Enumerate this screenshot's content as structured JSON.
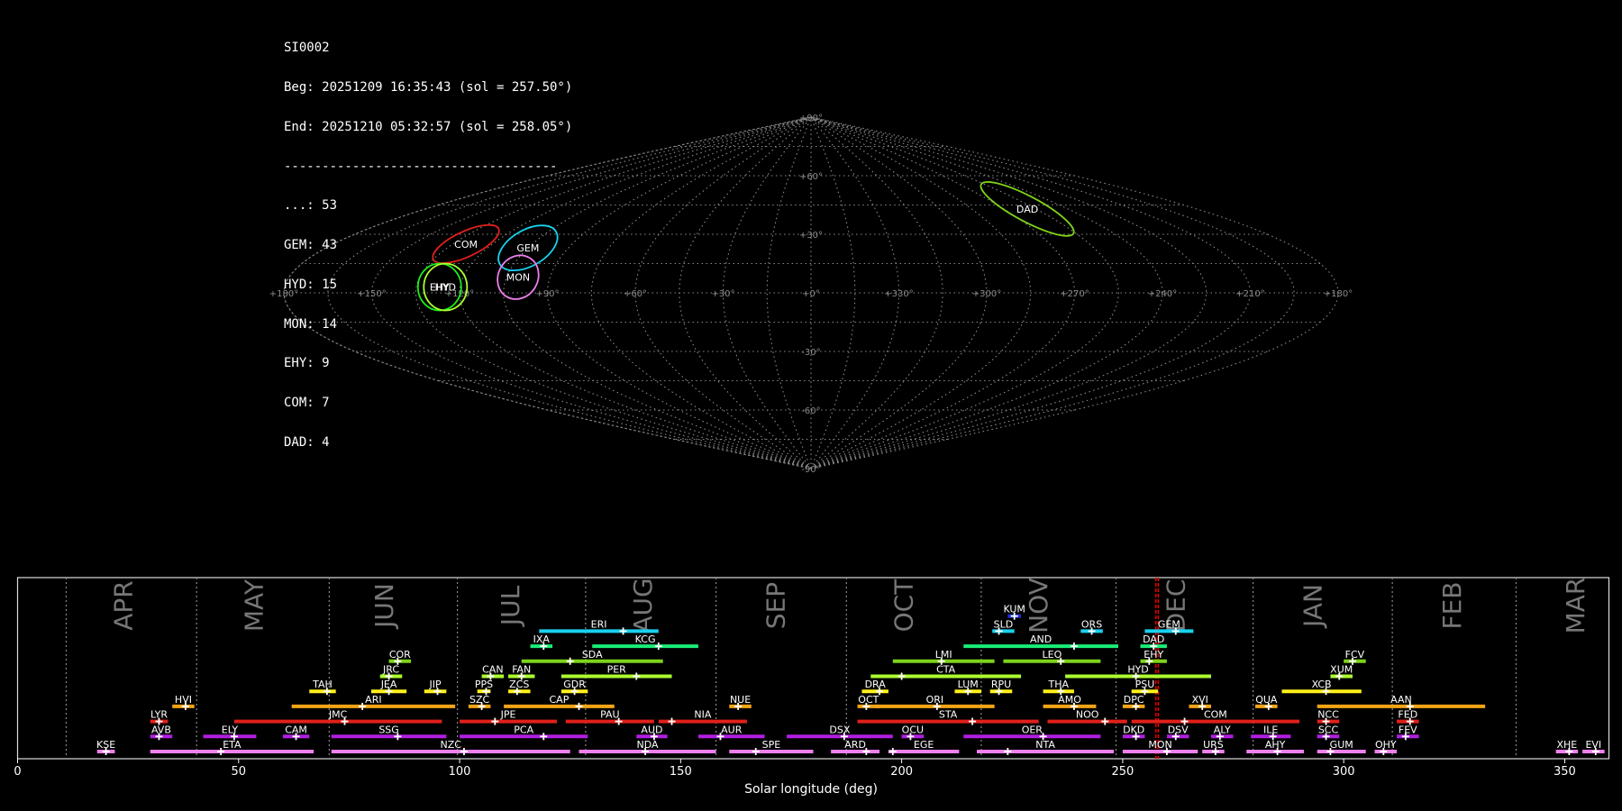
{
  "info": {
    "station": "SI0002",
    "begin": "Beg: 20251209 16:35:43 (sol = 257.50°)",
    "end": "End: 20251210 05:32:57 (sol = 258.05°)",
    "separator": "------------------------------------",
    "counts": [
      "...: 53",
      "GEM: 43",
      "HYD: 15",
      "MON: 14",
      "EHY: 9",
      "COM: 7",
      "DAD: 4"
    ]
  },
  "sky_map": {
    "projection": "sinusoidal",
    "lon_labels": [
      "+180°",
      "+150°",
      "+120°",
      "+90°",
      "+60°",
      "+30°",
      "+0°",
      "+330°",
      "+300°",
      "+270°",
      "+240°",
      "+210°",
      "+180°"
    ],
    "lat_labels": [
      "+90°",
      "+60°",
      "+30°",
      "+0°",
      "-30°",
      "-60°",
      "-90°"
    ],
    "showers": [
      {
        "code": "COM",
        "color": "#e0201a",
        "ra": 130,
        "dec": 25
      },
      {
        "code": "GEM",
        "color": "#19d2ee",
        "ra": 105,
        "dec": 23
      },
      {
        "code": "MON",
        "color": "#ee80ee",
        "ra": 101,
        "dec": 8
      },
      {
        "code": "EHY",
        "color": "#19ee19",
        "ra": 127,
        "dec": 3
      },
      {
        "code": "HYD",
        "color": "#adff2f",
        "ra": 125,
        "dec": 3
      },
      {
        "code": "DAD",
        "color": "#7ed31a",
        "ra": 259,
        "dec": 43
      }
    ]
  },
  "chart_data": {
    "type": "timeline",
    "xlabel": "Solar longitude (deg)",
    "xlim": [
      0,
      360
    ],
    "xticks": [
      0,
      50,
      100,
      150,
      200,
      250,
      300,
      350
    ],
    "current_sol": [
      257.5,
      258.05
    ],
    "months": [
      {
        "name": "APR",
        "start": 11,
        "label_at": 24
      },
      {
        "name": "MAY",
        "start": 40.5,
        "label_at": 53.5
      },
      {
        "name": "JUN",
        "start": 70.5,
        "label_at": 83
      },
      {
        "name": "JUL",
        "start": 99.5,
        "label_at": 111.5
      },
      {
        "name": "AUG",
        "start": 128.5,
        "label_at": 141.5
      },
      {
        "name": "SEP",
        "start": 158,
        "label_at": 171.5
      },
      {
        "name": "OCT",
        "start": 187.5,
        "label_at": 200.5
      },
      {
        "name": "NOV",
        "start": 218,
        "label_at": 231
      },
      {
        "name": "DEC",
        "start": 248.5,
        "label_at": 262
      },
      {
        "name": "JAN",
        "start": 279.5,
        "label_at": 293
      },
      {
        "name": "FEB",
        "start": 311,
        "label_at": 324.5
      },
      {
        "name": "MAR",
        "start": 339,
        "label_at": 352.5
      }
    ],
    "showers": [
      {
        "code": "KUM",
        "start": 224,
        "end": 227,
        "peak": 225.5,
        "row": 9,
        "color": "#1f2fd6"
      },
      {
        "code": "ERI",
        "start": 118,
        "end": 145,
        "peak": 137,
        "row": 8,
        "color": "#19d2ee"
      },
      {
        "code": "SLD",
        "start": 220.5,
        "end": 225.5,
        "peak": 222,
        "row": 8,
        "color": "#19d2ee"
      },
      {
        "code": "ORS",
        "start": 240.5,
        "end": 245.5,
        "peak": 243,
        "row": 8,
        "color": "#19d2ee"
      },
      {
        "code": "GEM",
        "start": 255,
        "end": 266,
        "peak": 262,
        "row": 8,
        "color": "#19d2ee"
      },
      {
        "code": "IXA",
        "start": 116,
        "end": 121,
        "peak": 119,
        "row": 7,
        "color": "#19ee76"
      },
      {
        "code": "KCG",
        "start": 130,
        "end": 154,
        "peak": 145,
        "row": 7,
        "color": "#19ee76"
      },
      {
        "code": "AND",
        "start": 214,
        "end": 249,
        "peak": 239,
        "row": 7,
        "color": "#19ee76"
      },
      {
        "code": "DAD",
        "start": 254,
        "end": 260,
        "peak": 257,
        "row": 7,
        "color": "#19ee76"
      },
      {
        "code": "COR",
        "start": 84,
        "end": 89,
        "peak": 86,
        "row": 6,
        "color": "#7ed31a"
      },
      {
        "code": "SDA",
        "start": 114,
        "end": 146,
        "peak": 125,
        "row": 6,
        "color": "#7ed31a"
      },
      {
        "code": "LMI",
        "start": 198,
        "end": 221,
        "peak": 209,
        "row": 6,
        "color": "#7ed31a"
      },
      {
        "code": "LEO",
        "start": 223,
        "end": 245,
        "peak": 236,
        "row": 6,
        "color": "#7ed31a"
      },
      {
        "code": "EHY",
        "start": 254,
        "end": 260,
        "peak": 256,
        "row": 6,
        "color": "#7ed31a"
      },
      {
        "code": "FCV",
        "start": 300,
        "end": 305,
        "peak": 302,
        "row": 6,
        "color": "#7ed31a"
      },
      {
        "code": "JRC",
        "start": 82,
        "end": 87,
        "peak": 84,
        "row": 5,
        "color": "#adff2f"
      },
      {
        "code": "CAN",
        "start": 105,
        "end": 110,
        "peak": 107,
        "row": 5,
        "color": "#adff2f"
      },
      {
        "code": "FAN",
        "start": 111,
        "end": 117,
        "peak": 114,
        "row": 5,
        "color": "#adff2f"
      },
      {
        "code": "PER",
        "start": 123,
        "end": 148,
        "peak": 140,
        "row": 5,
        "color": "#adff2f"
      },
      {
        "code": "CTA",
        "start": 193,
        "end": 227,
        "peak": 200,
        "row": 5,
        "color": "#adff2f"
      },
      {
        "code": "HYD",
        "start": 237,
        "end": 270,
        "peak": 253,
        "row": 5,
        "color": "#adff2f"
      },
      {
        "code": "XUM",
        "start": 297,
        "end": 302,
        "peak": 299,
        "row": 5,
        "color": "#adff2f"
      },
      {
        "code": "TAH",
        "start": 66,
        "end": 72,
        "peak": 70,
        "row": 4,
        "color": "#fff119"
      },
      {
        "code": "JEA",
        "start": 80,
        "end": 88,
        "peak": 84,
        "row": 4,
        "color": "#fff119"
      },
      {
        "code": "JIP",
        "start": 92,
        "end": 97,
        "peak": 95,
        "row": 4,
        "color": "#fff119"
      },
      {
        "code": "PPS",
        "start": 104,
        "end": 107,
        "peak": 106,
        "row": 4,
        "color": "#fff119"
      },
      {
        "code": "ZCS",
        "start": 111,
        "end": 116,
        "peak": 113,
        "row": 4,
        "color": "#fff119"
      },
      {
        "code": "GDR",
        "start": 123,
        "end": 129,
        "peak": 126,
        "row": 4,
        "color": "#fff119"
      },
      {
        "code": "DRA",
        "start": 191,
        "end": 197,
        "peak": 195,
        "row": 4,
        "color": "#fff119"
      },
      {
        "code": "LUM",
        "start": 212,
        "end": 218,
        "peak": 215,
        "row": 4,
        "color": "#fff119"
      },
      {
        "code": "RPU",
        "start": 220,
        "end": 225,
        "peak": 222,
        "row": 4,
        "color": "#fff119"
      },
      {
        "code": "THA",
        "start": 232,
        "end": 239,
        "peak": 236,
        "row": 4,
        "color": "#fff119"
      },
      {
        "code": "PSU",
        "start": 252,
        "end": 258,
        "peak": 255,
        "row": 4,
        "color": "#fff119"
      },
      {
        "code": "XCB",
        "start": 286,
        "end": 304,
        "peak": 296,
        "row": 4,
        "color": "#fff119"
      },
      {
        "code": "HVI",
        "start": 35,
        "end": 40,
        "peak": 38,
        "row": 3,
        "color": "#f2a416"
      },
      {
        "code": "ARI",
        "start": 62,
        "end": 99,
        "peak": 78,
        "row": 3,
        "color": "#f2a416"
      },
      {
        "code": "SZC",
        "start": 102,
        "end": 107,
        "peak": 105,
        "row": 3,
        "color": "#f2a416"
      },
      {
        "code": "CAP",
        "start": 110,
        "end": 135,
        "peak": 127,
        "row": 3,
        "color": "#f2a416"
      },
      {
        "code": "NUE",
        "start": 161,
        "end": 166,
        "peak": 163,
        "row": 3,
        "color": "#f2a416"
      },
      {
        "code": "OCT",
        "start": 190,
        "end": 195,
        "peak": 192,
        "row": 3,
        "color": "#f2a416"
      },
      {
        "code": "ORI",
        "start": 194,
        "end": 221,
        "peak": 208,
        "row": 3,
        "color": "#f2a416"
      },
      {
        "code": "AMO",
        "start": 232,
        "end": 244,
        "peak": 239,
        "row": 3,
        "color": "#f2a416"
      },
      {
        "code": "DPC",
        "start": 250,
        "end": 255,
        "peak": 253,
        "row": 3,
        "color": "#f2a416"
      },
      {
        "code": "XVI",
        "start": 265,
        "end": 270,
        "peak": 268,
        "row": 3,
        "color": "#f2a416"
      },
      {
        "code": "QUA",
        "start": 280,
        "end": 285,
        "peak": 283,
        "row": 3,
        "color": "#f2a416"
      },
      {
        "code": "AAN",
        "start": 294,
        "end": 332,
        "peak": 315,
        "row": 3,
        "color": "#f2a416"
      },
      {
        "code": "LYR",
        "start": 30,
        "end": 34,
        "peak": 32,
        "row": 2,
        "color": "#e0201a"
      },
      {
        "code": "JMC",
        "start": 49,
        "end": 96,
        "peak": 74,
        "row": 2,
        "color": "#e0201a"
      },
      {
        "code": "JPE",
        "start": 100,
        "end": 122,
        "peak": 108,
        "row": 2,
        "color": "#e0201a"
      },
      {
        "code": "PAU",
        "start": 124,
        "end": 144,
        "peak": 136,
        "row": 2,
        "color": "#e0201a"
      },
      {
        "code": "NIA",
        "start": 145,
        "end": 165,
        "peak": 148,
        "row": 2,
        "color": "#e0201a"
      },
      {
        "code": "STA",
        "start": 190,
        "end": 231,
        "peak": 216,
        "row": 2,
        "color": "#e0201a"
      },
      {
        "code": "NOO",
        "start": 233,
        "end": 251,
        "peak": 246,
        "row": 2,
        "color": "#e0201a"
      },
      {
        "code": "COM",
        "start": 252,
        "end": 290,
        "peak": 264,
        "row": 2,
        "color": "#e0201a"
      },
      {
        "code": "NCC",
        "start": 294,
        "end": 299,
        "peak": 296,
        "row": 2,
        "color": "#e0201a"
      },
      {
        "code": "FED",
        "start": 312,
        "end": 317,
        "peak": 315,
        "row": 2,
        "color": "#e0201a"
      },
      {
        "code": "AVB",
        "start": 30,
        "end": 35,
        "peak": 32,
        "row": 1,
        "color": "#b01ee0"
      },
      {
        "code": "ELY",
        "start": 42,
        "end": 54,
        "peak": 49,
        "row": 1,
        "color": "#b01ee0"
      },
      {
        "code": "CAM",
        "start": 60,
        "end": 66,
        "peak": 63,
        "row": 1,
        "color": "#b01ee0"
      },
      {
        "code": "SSG",
        "start": 71,
        "end": 97,
        "peak": 86,
        "row": 1,
        "color": "#b01ee0"
      },
      {
        "code": "PCA",
        "start": 100,
        "end": 129,
        "peak": 119,
        "row": 1,
        "color": "#b01ee0"
      },
      {
        "code": "AUD",
        "start": 140,
        "end": 147,
        "peak": 144,
        "row": 1,
        "color": "#b01ee0"
      },
      {
        "code": "AUR",
        "start": 154,
        "end": 169,
        "peak": 159,
        "row": 1,
        "color": "#b01ee0"
      },
      {
        "code": "DSX",
        "start": 174,
        "end": 198,
        "peak": 187,
        "row": 1,
        "color": "#b01ee0"
      },
      {
        "code": "OCU",
        "start": 200,
        "end": 205,
        "peak": 202,
        "row": 1,
        "color": "#b01ee0"
      },
      {
        "code": "OER",
        "start": 214,
        "end": 245,
        "peak": 232,
        "row": 1,
        "color": "#b01ee0"
      },
      {
        "code": "DKD",
        "start": 250,
        "end": 255,
        "peak": 253,
        "row": 1,
        "color": "#b01ee0"
      },
      {
        "code": "DSV",
        "start": 260,
        "end": 265,
        "peak": 262,
        "row": 1,
        "color": "#b01ee0"
      },
      {
        "code": "ALY",
        "start": 270,
        "end": 275,
        "peak": 272,
        "row": 1,
        "color": "#b01ee0"
      },
      {
        "code": "ILE",
        "start": 279,
        "end": 288,
        "peak": 284,
        "row": 1,
        "color": "#b01ee0"
      },
      {
        "code": "SCC",
        "start": 294,
        "end": 299,
        "peak": 296,
        "row": 1,
        "color": "#b01ee0"
      },
      {
        "code": "FEV",
        "start": 312,
        "end": 317,
        "peak": 314,
        "row": 1,
        "color": "#b01ee0"
      },
      {
        "code": "KSE",
        "start": 18,
        "end": 22,
        "peak": 20,
        "row": 0,
        "color": "#ee80ee"
      },
      {
        "code": "ETA",
        "start": 30,
        "end": 67,
        "peak": 46,
        "row": 0,
        "color": "#ee80ee"
      },
      {
        "code": "NZC",
        "start": 71,
        "end": 125,
        "peak": 101,
        "row": 0,
        "color": "#ee80ee"
      },
      {
        "code": "NDA",
        "start": 127,
        "end": 158,
        "peak": 142,
        "row": 0,
        "color": "#ee80ee"
      },
      {
        "code": "SPE",
        "start": 161,
        "end": 180,
        "peak": 167,
        "row": 0,
        "color": "#ee80ee"
      },
      {
        "code": "ARD",
        "start": 184,
        "end": 195,
        "peak": 192,
        "row": 0,
        "color": "#ee80ee"
      },
      {
        "code": "EGE",
        "start": 197,
        "end": 213,
        "peak": 198,
        "row": 0,
        "color": "#ee80ee"
      },
      {
        "code": "NTA",
        "start": 217,
        "end": 248,
        "peak": 224,
        "row": 0,
        "color": "#ee80ee"
      },
      {
        "code": "MON",
        "start": 250,
        "end": 267,
        "peak": 260,
        "row": 0,
        "color": "#ee80ee"
      },
      {
        "code": "URS",
        "start": 268,
        "end": 273,
        "peak": 271,
        "row": 0,
        "color": "#ee80ee"
      },
      {
        "code": "AHY",
        "start": 278,
        "end": 291,
        "peak": 285,
        "row": 0,
        "color": "#ee80ee"
      },
      {
        "code": "GUM",
        "start": 294,
        "end": 305,
        "peak": 297,
        "row": 0,
        "color": "#ee80ee"
      },
      {
        "code": "OHY",
        "start": 307,
        "end": 312,
        "peak": 309,
        "row": 0,
        "color": "#ee80ee"
      },
      {
        "code": "XHE",
        "start": 348,
        "end": 353,
        "peak": 351,
        "row": 0,
        "color": "#ee80ee"
      },
      {
        "code": "EVI",
        "start": 354,
        "end": 359,
        "peak": 357,
        "row": 0,
        "color": "#ee80ee"
      }
    ]
  }
}
